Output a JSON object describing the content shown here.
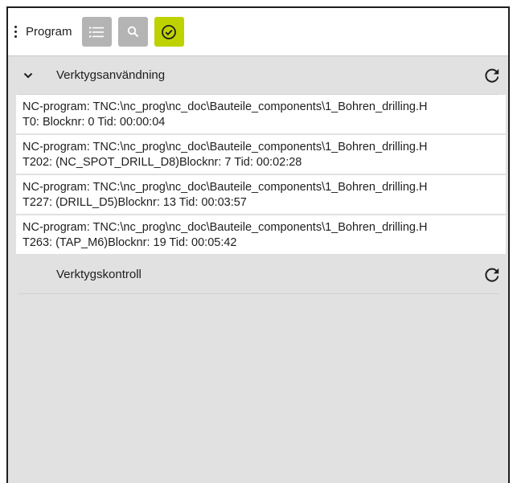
{
  "toolbar": {
    "title": "Program",
    "buttons": [
      {
        "icon": "list-icon",
        "state": "inactive"
      },
      {
        "icon": "search-icon",
        "state": "inactive"
      },
      {
        "icon": "check-circle-icon",
        "state": "active"
      }
    ]
  },
  "colors": {
    "active_button": "#bed200",
    "inactive_button": "#b4b4b4",
    "panel_background": "#e1e1e1"
  },
  "sections": {
    "tool_usage": {
      "label": "Verktygsanvändning",
      "expanded": true,
      "entries": [
        {
          "line1": "NC-program: TNC:\\nc_prog\\nc_doc\\Bauteile_components\\1_Bohren_drilling.H",
          "line2": "T0: Blocknr: 0 Tid: 00:00:04"
        },
        {
          "line1": "NC-program: TNC:\\nc_prog\\nc_doc\\Bauteile_components\\1_Bohren_drilling.H",
          "line2": "T202: (NC_SPOT_DRILL_D8)Blocknr: 7 Tid: 00:02:28"
        },
        {
          "line1": "NC-program: TNC:\\nc_prog\\nc_doc\\Bauteile_components\\1_Bohren_drilling.H",
          "line2": "T227: (DRILL_D5)Blocknr: 13 Tid: 00:03:57"
        },
        {
          "line1": "NC-program: TNC:\\nc_prog\\nc_doc\\Bauteile_components\\1_Bohren_drilling.H",
          "line2": "T263: (TAP_M6)Blocknr: 19 Tid: 00:05:42"
        }
      ]
    },
    "tool_check": {
      "label": "Verktygskontroll",
      "expanded": false
    }
  }
}
